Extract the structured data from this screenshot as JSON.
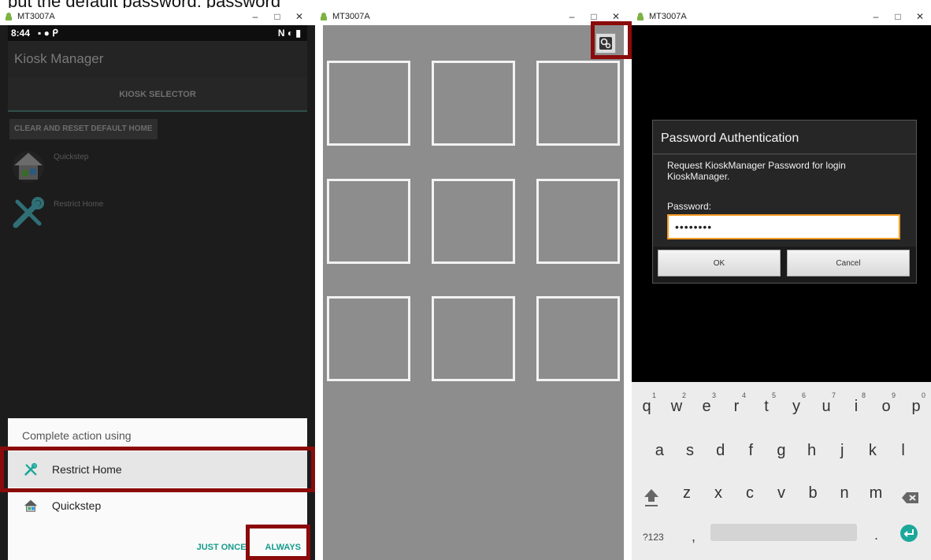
{
  "caption_fragment": "put the default password: password",
  "windows": [
    {
      "title": "MT3007A",
      "controls": [
        "–",
        "□",
        "✕"
      ]
    },
    {
      "title": "MT3007A",
      "controls": [
        "–",
        "□",
        "✕"
      ]
    },
    {
      "title": "MT3007A",
      "controls": [
        "–",
        "□",
        "✕"
      ]
    }
  ],
  "panel1": {
    "status_time": "8:44",
    "status_icons_left": "▪ ● ᑭ",
    "status_icons_right": "N ◐ ▮",
    "app_title": "Kiosk Manager",
    "tab_label": "KIOSK SELECTOR",
    "clear_button": "CLEAR AND RESET DEFAULT HOME",
    "home_items": [
      {
        "label": "Quickstep",
        "icon": "house-icon"
      },
      {
        "label": "Restrict Home",
        "icon": "tools-icon"
      }
    ],
    "sheet": {
      "header": "Complete action using",
      "options": [
        {
          "label": "Restrict Home",
          "icon": "tools-icon"
        },
        {
          "label": "Quickstep",
          "icon": "house-icon"
        }
      ],
      "just_once": "JUST ONCE",
      "always": "ALWAYS"
    }
  },
  "panel2": {
    "tiles": 9,
    "settings_icon": "settings-gear-icon"
  },
  "panel3": {
    "dialog_title": "Password Authentication",
    "message": "Request KioskManager Password for login KioskManager.",
    "password_label": "Password:",
    "password_value": "••••••••",
    "ok": "OK",
    "cancel": "Cancel",
    "keyboard": {
      "row1": [
        "q",
        "w",
        "e",
        "r",
        "t",
        "y",
        "u",
        "i",
        "o",
        "p"
      ],
      "row1_nums": [
        "1",
        "2",
        "3",
        "4",
        "5",
        "6",
        "7",
        "8",
        "9",
        "0"
      ],
      "row2": [
        "a",
        "s",
        "d",
        "f",
        "g",
        "h",
        "j",
        "k",
        "l"
      ],
      "row3": [
        "z",
        "x",
        "c",
        "v",
        "b",
        "n",
        "m"
      ],
      "symbols_key": "?123",
      "comma": ",",
      "period": "."
    }
  },
  "colors": {
    "highlight_frame": "#8b0a0a",
    "teal_accent": "#159c8c",
    "focus_orange": "#f59a23"
  }
}
